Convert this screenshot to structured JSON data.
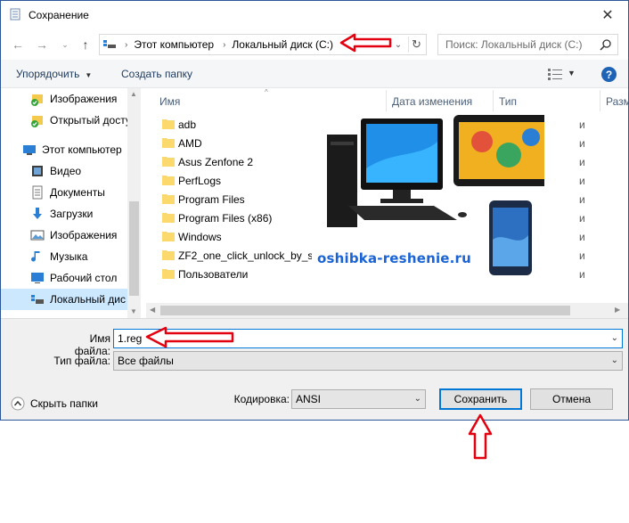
{
  "window": {
    "title": "Сохранение",
    "close_glyph": "✕"
  },
  "address": {
    "crumbs": [
      "Этот компьютер",
      "Локальный диск (C:)"
    ],
    "separator": "›",
    "search_placeholder": "Поиск: Локальный диск (C:)"
  },
  "toolbar": {
    "organize_label": "Упорядочить",
    "new_folder_label": "Создать папку",
    "help_label": "?"
  },
  "nav": {
    "items": [
      {
        "label": "Изображения",
        "icon": "pictures-synced-icon"
      },
      {
        "label": "Открытый досту",
        "icon": "shared-synced-icon"
      },
      {
        "label": "Этот компьютер",
        "icon": "this-pc-icon"
      },
      {
        "label": "Видео",
        "icon": "video-icon"
      },
      {
        "label": "Документы",
        "icon": "documents-icon"
      },
      {
        "label": "Загрузки",
        "icon": "downloads-icon"
      },
      {
        "label": "Изображения",
        "icon": "pictures-icon"
      },
      {
        "label": "Музыка",
        "icon": "music-icon"
      },
      {
        "label": "Рабочий стол",
        "icon": "desktop-icon"
      },
      {
        "label": "Локальный дис",
        "icon": "local-disk-icon"
      }
    ]
  },
  "files": {
    "columns": [
      "Имя",
      "Дата изменения",
      "Тип",
      "Разм"
    ],
    "rows": [
      {
        "name": "adb",
        "type": "и"
      },
      {
        "name": "AMD",
        "type": "и"
      },
      {
        "name": "Asus Zenfone 2",
        "type": "и"
      },
      {
        "name": "PerfLogs",
        "type": "и"
      },
      {
        "name": "Program Files",
        "type": "и"
      },
      {
        "name": "Program Files (x86)",
        "type": "и"
      },
      {
        "name": "Windows",
        "type": "и"
      },
      {
        "name": "ZF2_one_click_unlock_by_so",
        "type": "и"
      },
      {
        "name": "Пользователи",
        "type": "и"
      }
    ]
  },
  "watermark": "oshibka-reshenie.ru",
  "form": {
    "filename_label": "Имя файла:",
    "filename_value": "1.reg",
    "filetype_label": "Тип файла:",
    "filetype_value": "Все файлы",
    "encoding_label": "Кодировка:",
    "encoding_value": "ANSI",
    "save_label": "Сохранить",
    "cancel_label": "Отмена",
    "hide_folders_label": "Скрыть папки"
  },
  "colors": {
    "accent": "#0078d7",
    "annotation_red": "#e3000f",
    "watermark": "#1a63d6",
    "folder": "#f8d775"
  }
}
